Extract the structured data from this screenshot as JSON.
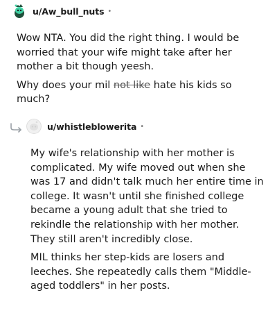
{
  "comments": [
    {
      "username": "u/Aw_bull_nuts",
      "dot": "•",
      "paragraph1": "Wow NTA. You did the right thing. I would be worried that your wife might take after her mother a bit though yeesh.",
      "paragraph2": {
        "prefix": "Why does your mil ",
        "strike": "not like",
        "suffix": " hate his kids so much?"
      }
    },
    {
      "username": "u/whistleblowerita",
      "dot": "•",
      "paragraph1": "My wife's relationship with her mother is complicated. My wife moved out when she was 17 and didn't talk much her entire time in college. It wasn't until she finished college became a young adult that she tried to rekindle the relationship with her mother. They still aren't incredibly close.",
      "paragraph2": "MIL thinks her step-kids are losers and leeches. She repeatedly calls them \"Middle-aged toddlers\" in her posts."
    }
  ],
  "icons": {
    "avatar1": "snoo-avatar-icon",
    "avatar2": "default-avatar-icon",
    "reply": "reply-arrow-icon"
  },
  "colors": {
    "text": "#1c1c1c",
    "meta": "#7c7c7c",
    "avatar1_bg": "#1f4f3a",
    "avatar1_accent": "#3fd1a3",
    "avatar2": "#e4e4e4"
  }
}
